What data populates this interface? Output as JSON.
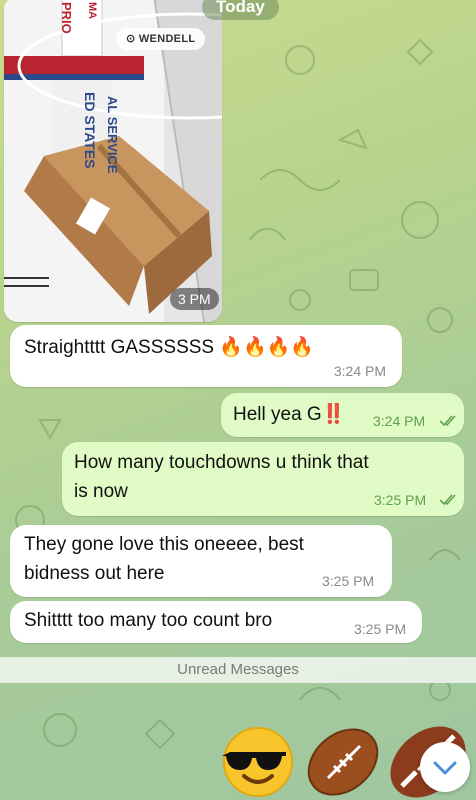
{
  "chat": {
    "date_label": "Today",
    "photo": {
      "location_label": "WENDELL",
      "time": "3 PM",
      "box_text_top": "PRIO",
      "box_text_top2": "MA",
      "box_text_side1": "ED STATES",
      "box_text_side2": "AL SERVICE"
    },
    "messages": [
      {
        "direction": "in",
        "text": "Straightttt GASSSSSS",
        "emoji": "🔥🔥🔥🔥",
        "time": "3:24 PM"
      },
      {
        "direction": "out",
        "text": "Hell yea G",
        "emoji": "‼️",
        "time": "3:24 PM"
      },
      {
        "direction": "out",
        "text_line1": "How many touchdowns u think that",
        "text_line2": "is now",
        "time": "3:25 PM"
      },
      {
        "direction": "in",
        "text_line1": "They gone love this oneeee, best",
        "text_line2": "bidness out here",
        "time": "3:25 PM"
      },
      {
        "direction": "in",
        "text": "Shitttt too many too count bro",
        "time": "3:25 PM"
      }
    ],
    "unread_label": "Unread Messages",
    "emoji_reactions": [
      "sunglasses-emoji",
      "football-emoji",
      "football-emoji"
    ]
  },
  "colors": {
    "outgoing_bubble": "#e1fbc6",
    "incoming_bubble": "#ffffff",
    "check_color": "#5fa14e"
  }
}
